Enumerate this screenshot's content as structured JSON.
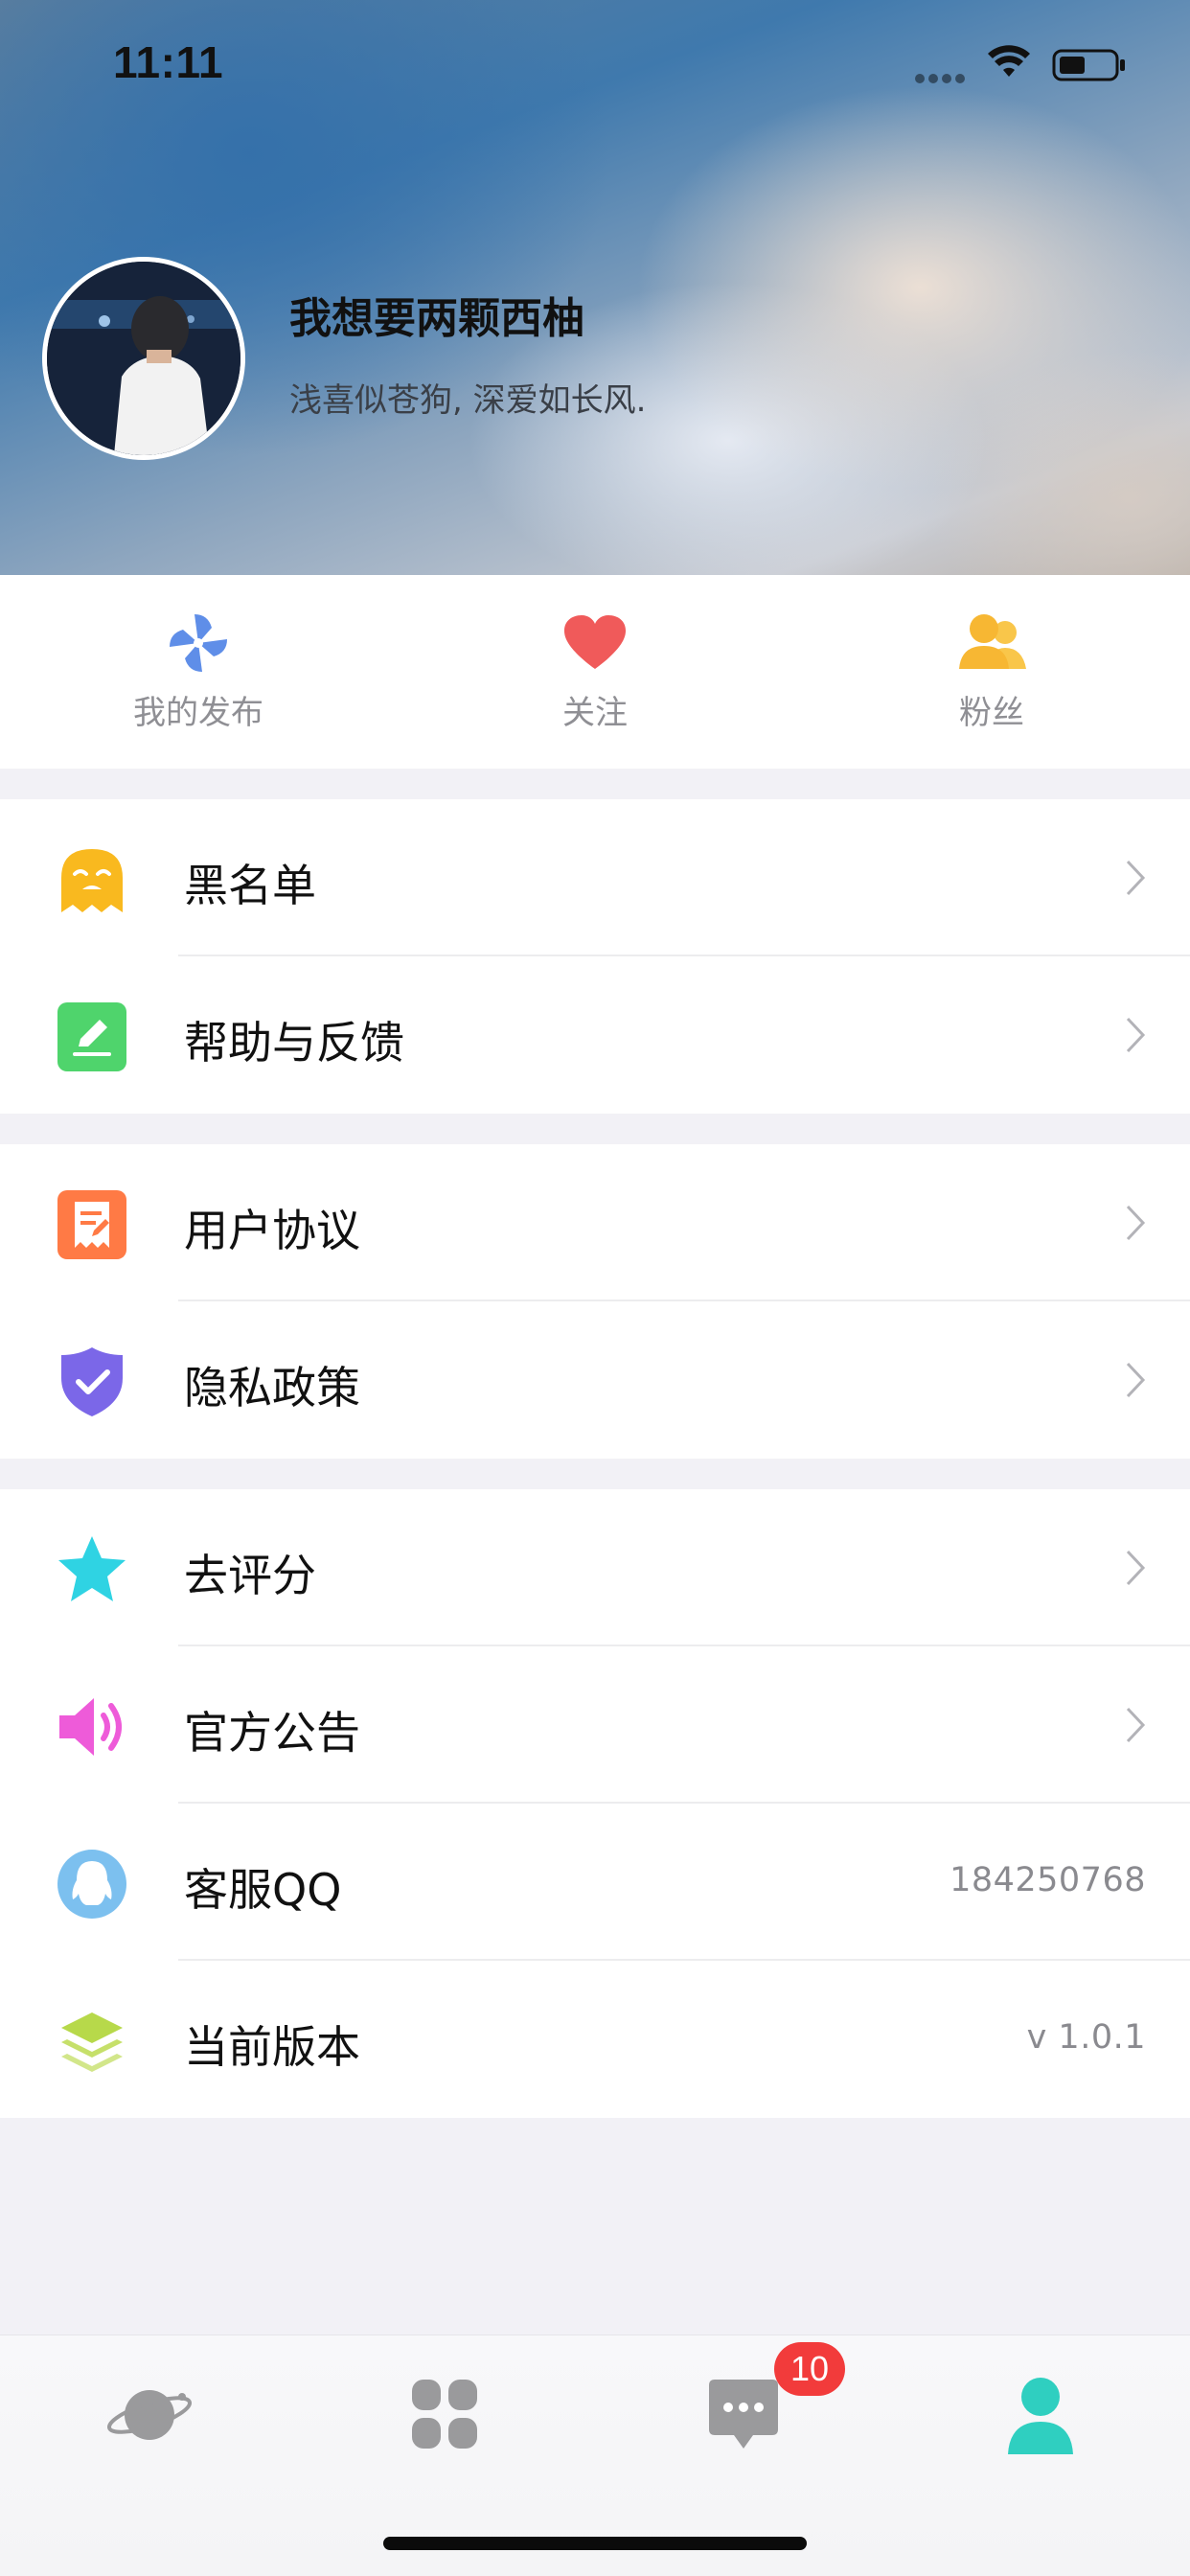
{
  "status_bar": {
    "time": "11:11"
  },
  "profile": {
    "name": "我想要两颗西柚",
    "bio": "浅喜似苍狗, 深爱如长风."
  },
  "quick_actions": [
    {
      "label": "我的发布",
      "icon": "pinwheel-icon",
      "color": "#5f8ee8"
    },
    {
      "label": "关注",
      "icon": "heart-icon",
      "color": "#f05a5a"
    },
    {
      "label": "粉丝",
      "icon": "users-icon",
      "color": "#f7b733"
    }
  ],
  "menu_groups": [
    [
      {
        "label": "黑名单",
        "icon": "ghost-icon",
        "color": "#f9b91f"
      },
      {
        "label": "帮助与反馈",
        "icon": "edit-icon",
        "color": "#4fd46c"
      }
    ],
    [
      {
        "label": "用户协议",
        "icon": "document-icon",
        "color": "#ff7a45"
      },
      {
        "label": "隐私政策",
        "icon": "shield-check-icon",
        "color": "#7b67e8"
      }
    ],
    [
      {
        "label": "去评分",
        "icon": "star-icon",
        "color": "#2fd3e3"
      },
      {
        "label": "官方公告",
        "icon": "speaker-icon",
        "color": "#ee5bd9"
      },
      {
        "label": "客服QQ",
        "icon": "qq-penguin-icon",
        "color": "#5aa9e6",
        "value": "184250768"
      },
      {
        "label": "当前版本",
        "icon": "layers-icon",
        "color": "#b7d94a",
        "value": "v 1.0.1"
      }
    ]
  ],
  "tab_bar": {
    "tabs": [
      {
        "icon": "planet-icon",
        "active": false
      },
      {
        "icon": "grid-icon",
        "active": false
      },
      {
        "icon": "chat-icon",
        "active": false
      },
      {
        "icon": "profile-icon",
        "active": true
      }
    ],
    "badge": "10",
    "active_color": "#2fcfc0",
    "inactive_color": "#9a9a9c"
  }
}
